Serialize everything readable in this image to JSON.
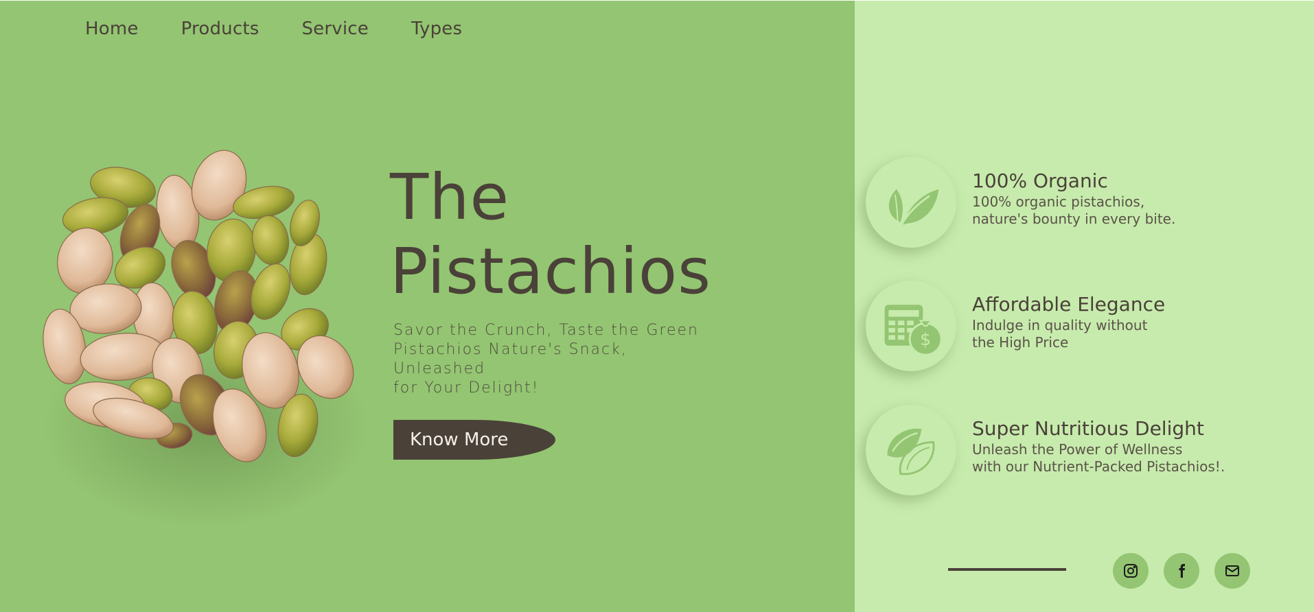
{
  "nav": {
    "items": [
      {
        "label": "Home"
      },
      {
        "label": "Products"
      },
      {
        "label": "Service"
      },
      {
        "label": "Types"
      }
    ]
  },
  "hero": {
    "title_line1": "The",
    "title_line2": "Pistachios",
    "subtitle_line1": "Savor the Crunch, Taste the Green",
    "subtitle_line2": "Pistachios Nature's Snack, Unleashed",
    "subtitle_line3": "for Your Delight!",
    "button_label": "Know More"
  },
  "features": [
    {
      "icon": "leaf-icon",
      "title": "100% Organic",
      "line1": "100% organic pistachios,",
      "line2": "nature's bounty in every bite."
    },
    {
      "icon": "price-money-bag-icon",
      "title": "Affordable Elegance",
      "line1": "Indulge in quality without",
      "line2": "the High Price"
    },
    {
      "icon": "pistachio-icon",
      "title": "Super Nutritious Delight",
      "line1": "Unleash the Power of Wellness",
      "line2": "with our Nutrient-Packed Pistachios!."
    }
  ],
  "social": [
    {
      "icon": "instagram-icon"
    },
    {
      "icon": "facebook-icon"
    },
    {
      "icon": "email-icon"
    }
  ],
  "colors": {
    "left_bg": "#94c572",
    "right_bg": "#c7ebad",
    "text_dark": "#4a4139",
    "button_bg": "#4a4139"
  }
}
